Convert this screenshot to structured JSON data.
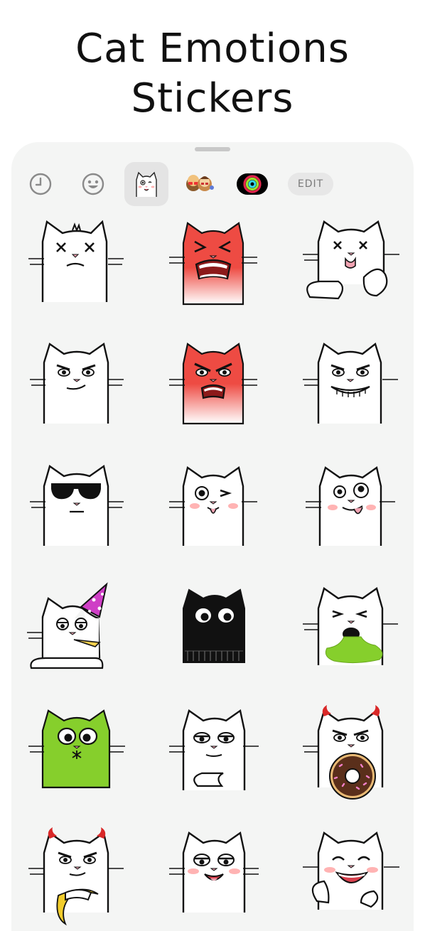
{
  "header": {
    "title_line1": "Cat Emotions",
    "title_line2": "Stickers"
  },
  "tab_bar": {
    "tabs": [
      {
        "name": "recents",
        "icon": "clock-icon",
        "active": false
      },
      {
        "name": "emoji",
        "icon": "smiley-icon",
        "active": false
      },
      {
        "name": "cat-emotions-pack",
        "icon": "cat-sticker-icon",
        "active": true
      },
      {
        "name": "memoji",
        "icon": "memoji-icon",
        "active": false
      },
      {
        "name": "activity",
        "icon": "activity-rings-icon",
        "active": false
      }
    ],
    "edit_label": "EDIT"
  },
  "stickers": [
    {
      "id": "dizzy-cat"
    },
    {
      "id": "furious-red-cat"
    },
    {
      "id": "knocked-out-cat"
    },
    {
      "id": "smug-cat"
    },
    {
      "id": "angry-red-cat"
    },
    {
      "id": "grinning-cat"
    },
    {
      "id": "sunglasses-cat"
    },
    {
      "id": "winking-cat"
    },
    {
      "id": "silly-tongue-cat"
    },
    {
      "id": "party-hat-cat"
    },
    {
      "id": "black-hoodie-cat"
    },
    {
      "id": "vomiting-cat"
    },
    {
      "id": "green-shocked-cat"
    },
    {
      "id": "unimpressed-cat"
    },
    {
      "id": "devil-donut-cat"
    },
    {
      "id": "devil-banana-cat"
    },
    {
      "id": "flirty-cat"
    },
    {
      "id": "laughing-cat"
    }
  ],
  "colors": {
    "sheet_background": "#f4f5f4",
    "active_tab": "#e4e4e4",
    "edit_pill": "#e7e7e7",
    "angry_red": "#ee4b43",
    "slime_green": "#86cf2c",
    "party_hat_pink": "#cf3fc6",
    "donut_brown": "#5a2f1b"
  }
}
